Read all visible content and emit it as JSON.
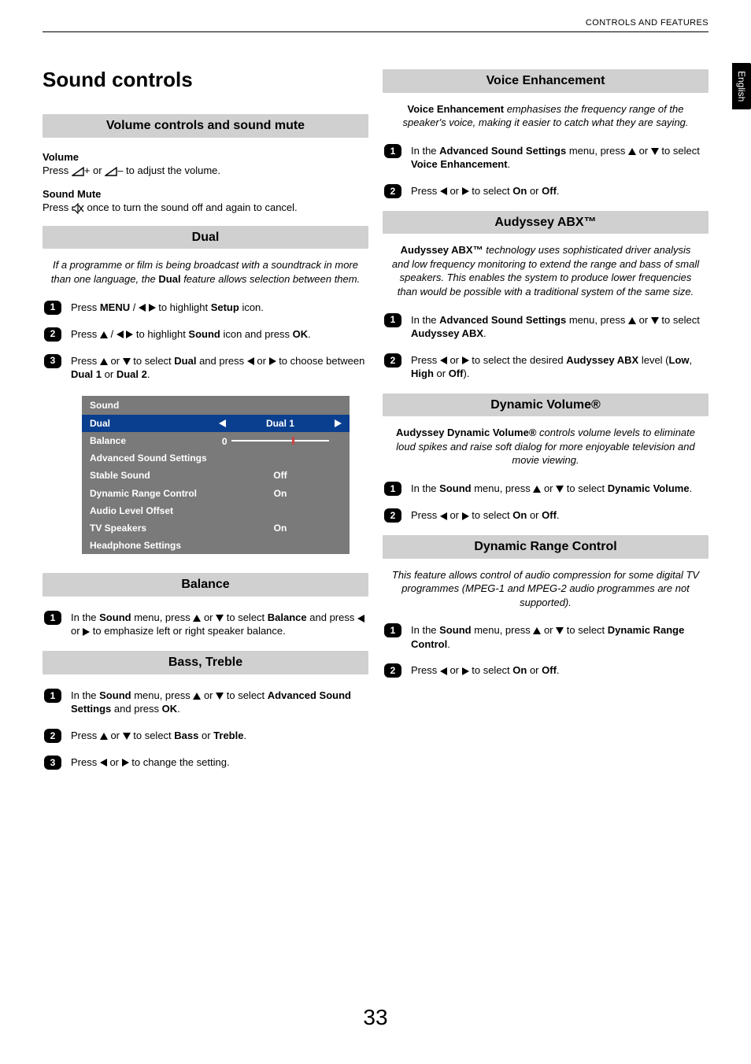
{
  "header": {
    "breadcrumb": "CONTROLS AND FEATURES"
  },
  "side_tab": "English",
  "page_number": "33",
  "title": "Sound controls",
  "left": {
    "volume_section": {
      "bar": "Volume controls and sound mute",
      "volume_h": "Volume",
      "volume_body_a": "Press ",
      "volume_body_b": "+ or ",
      "volume_body_c": "– to adjust the volume.",
      "mute_h": "Sound Mute",
      "mute_body_a": "Press ",
      "mute_body_b": " once to turn the sound off and again to cancel."
    },
    "dual_section": {
      "bar": "Dual",
      "intro_a": "If a programme or film is being broadcast with a soundtrack in more than one language, the ",
      "intro_b": "Dual",
      "intro_c": " feature allows selection between them.",
      "step1_a": "Press ",
      "step1_b": "MENU",
      "step1_c": " / ",
      "step1_d": " to highlight ",
      "step1_e": "Setup",
      "step1_f": " icon.",
      "step2_a": "Press ",
      "step2_b": " / ",
      "step2_c": " to highlight ",
      "step2_d": "Sound",
      "step2_e": " icon and press ",
      "step2_f": "OK",
      "step2_g": ".",
      "step3_a": "Press ",
      "step3_b": " or ",
      "step3_c": " to select ",
      "step3_d": "Dual",
      "step3_e": " and press ",
      "step3_f": " or ",
      "step3_g": " to choose between ",
      "step3_h": "Dual 1",
      "step3_i": " or ",
      "step3_j": "Dual 2",
      "step3_k": "."
    },
    "menu": {
      "title": "Sound",
      "rows": {
        "dual": {
          "label": "Dual",
          "value": "Dual 1"
        },
        "balance": {
          "label": "Balance",
          "zero": "0"
        },
        "ass": {
          "label": "Advanced Sound Settings"
        },
        "stable": {
          "label": "Stable Sound",
          "value": "Off"
        },
        "drc": {
          "label": "Dynamic Range Control",
          "value": "On"
        },
        "alo": {
          "label": "Audio Level Offset"
        },
        "tvs": {
          "label": "TV Speakers",
          "value": "On"
        },
        "hp": {
          "label": "Headphone Settings"
        }
      }
    },
    "balance_section": {
      "bar": "Balance",
      "step1_a": "In the ",
      "step1_b": "Sound",
      "step1_c": " menu, press ",
      "step1_d": " or ",
      "step1_e": " to select ",
      "step1_f": "Balance",
      "step1_g": " and press ",
      "step1_h": " or ",
      "step1_i": " to emphasize left or right speaker balance."
    },
    "bass_section": {
      "bar": "Bass, Treble",
      "step1_a": "In the ",
      "step1_b": "Sound",
      "step1_c": " menu, press ",
      "step1_d": " or ",
      "step1_e": " to select ",
      "step1_f": "Advanced Sound Settings",
      "step1_g": " and press ",
      "step1_h": "OK",
      "step1_i": ".",
      "step2_a": "Press ",
      "step2_b": " or ",
      "step2_c": " to select ",
      "step2_d": "Bass",
      "step2_e": " or ",
      "step2_f": "Treble",
      "step2_g": ".",
      "step3_a": "Press ",
      "step3_b": " or ",
      "step3_c": " to change the setting."
    }
  },
  "right": {
    "voice_section": {
      "bar": "Voice Enhancement",
      "intro_a": "Voice Enhancement",
      "intro_b": " emphasises the frequency range of the speaker's voice, making it easier to catch what they are saying.",
      "step1_a": "In the ",
      "step1_b": "Advanced Sound Settings",
      "step1_c": " menu, press ",
      "step1_d": " or ",
      "step1_e": " to select ",
      "step1_f": "Voice Enhancement",
      "step1_g": ".",
      "step2_a": "Press ",
      "step2_b": " or ",
      "step2_c": " to select ",
      "step2_d": "On",
      "step2_e": " or ",
      "step2_f": "Off",
      "step2_g": "."
    },
    "abx_section": {
      "bar": "Audyssey ABX™",
      "intro_a": "Audyssey ABX™",
      "intro_b": " technology uses sophisticated driver analysis and low frequency monitoring to extend the range and bass of small speakers. This enables the system to produce lower frequencies than would be possible with a traditional system of the same size.",
      "step1_a": "In the ",
      "step1_b": "Advanced Sound Settings",
      "step1_c": " menu, press ",
      "step1_d": " or ",
      "step1_e": " to select ",
      "step1_f": "Audyssey ABX",
      "step1_g": ".",
      "step2_a": "Press ",
      "step2_b": " or ",
      "step2_c": " to select the desired ",
      "step2_d": "Audyssey ABX",
      "step2_e": " level (",
      "step2_f": "Low",
      "step2_g": ", ",
      "step2_h": "High",
      "step2_i": " or ",
      "step2_j": "Off",
      "step2_k": ")."
    },
    "dynvol_section": {
      "bar": "Dynamic Volume®",
      "intro_a": "Audyssey Dynamic Volume®",
      "intro_b": " controls volume levels to eliminate loud spikes and raise soft dialog for more enjoyable television and movie viewing.",
      "step1_a": "In the ",
      "step1_b": "Sound",
      "step1_c": " menu, press ",
      "step1_d": " or ",
      "step1_e": " to select ",
      "step1_f": "Dynamic Volume",
      "step1_g": ".",
      "step2_a": "Press ",
      "step2_b": " or ",
      "step2_c": " to select ",
      "step2_d": "On",
      "step2_e": " or ",
      "step2_f": "Off",
      "step2_g": "."
    },
    "drc_section": {
      "bar": "Dynamic Range Control",
      "intro": "This feature allows control of audio compression for some digital TV programmes (MPEG-1 and MPEG-2 audio programmes are not supported).",
      "step1_a": "In the ",
      "step1_b": "Sound",
      "step1_c": " menu, press ",
      "step1_d": " or ",
      "step1_e": " to select ",
      "step1_f": "Dynamic Range Control",
      "step1_g": ".",
      "step2_a": "Press ",
      "step2_b": " or ",
      "step2_c": " to select ",
      "step2_d": "On",
      "step2_e": " or ",
      "step2_f": "Off",
      "step2_g": "."
    }
  }
}
